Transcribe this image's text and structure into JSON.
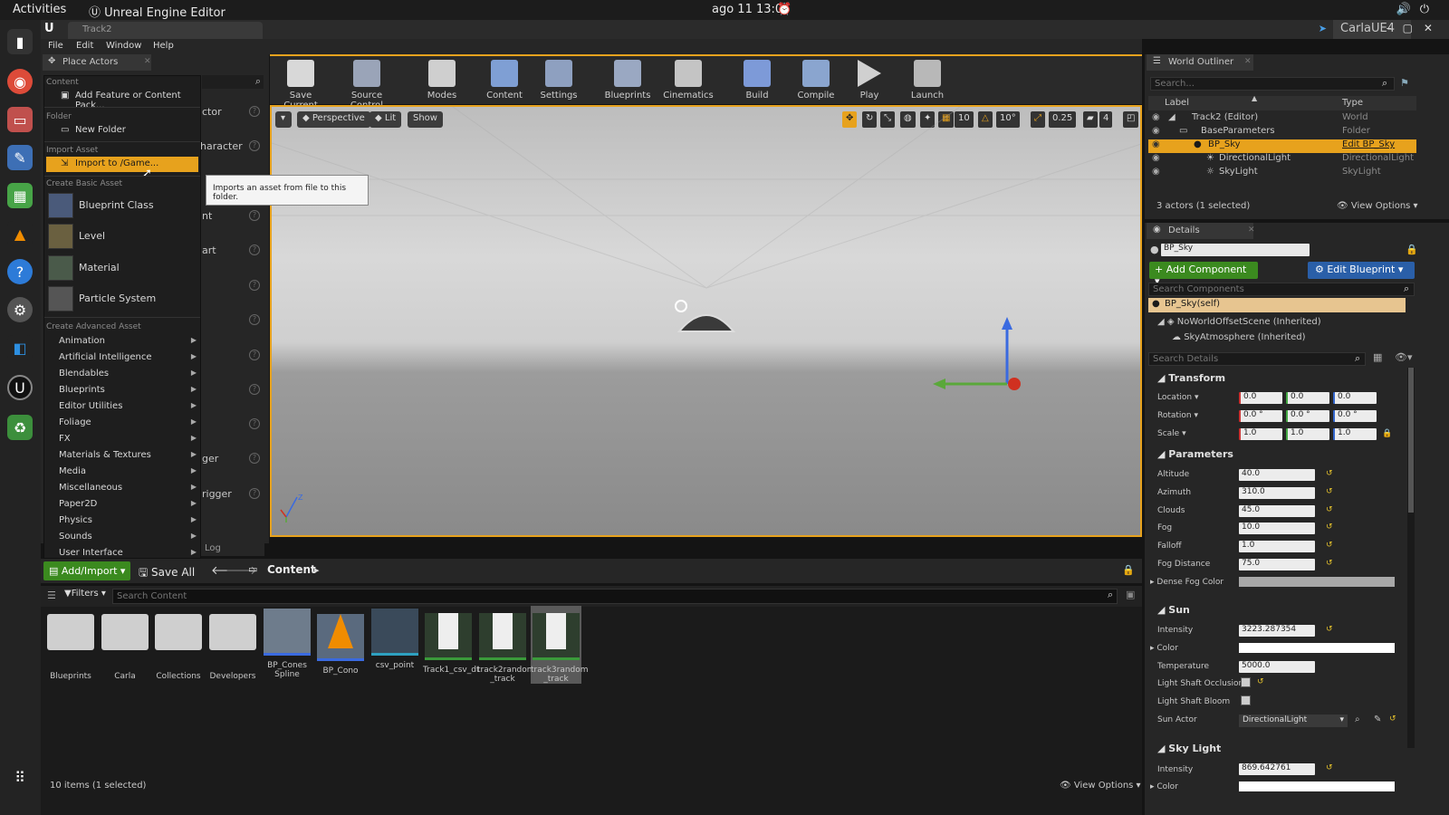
{
  "os": {
    "activities": "Activities",
    "app_name": "Unreal Engine Editor",
    "clock": "ago 11  13:04"
  },
  "window": {
    "tab_title": "Track2",
    "project": "CarlaUE4"
  },
  "menu": [
    "File",
    "Edit",
    "Window",
    "Help"
  ],
  "place_actors": {
    "tab": "Place Actors",
    "partial_labels": [
      "ctor",
      "haracter",
      "nt",
      "art",
      "ger",
      "rigger"
    ]
  },
  "dropdown": {
    "content_header": "Content",
    "add_feature": "Add Feature or Content Pack...",
    "folder_header": "Folder",
    "new_folder": "New Folder",
    "import_header": "Import Asset",
    "import_item": "Import to /Game...",
    "basic_header": "Create Basic Asset",
    "basic_items": [
      "Blueprint Class",
      "Level",
      "Material",
      "Particle System"
    ],
    "advanced_header": "Create Advanced Asset",
    "advanced_items": [
      "Animation",
      "Artificial Intelligence",
      "Blendables",
      "Blueprints",
      "Editor Utilities",
      "Foliage",
      "FX",
      "Materials & Textures",
      "Media",
      "Miscellaneous",
      "Paper2D",
      "Physics",
      "Sounds",
      "User Interface"
    ]
  },
  "tooltip": "Imports an asset from file to this folder.",
  "toolbar": [
    "Save Current",
    "Source Control",
    "Modes",
    "Content",
    "Settings",
    "Blueprints",
    "Cinematics",
    "Build",
    "Compile",
    "Play",
    "Launch"
  ],
  "viewport": {
    "perspective": "Perspective",
    "lit": "Lit",
    "show": "Show",
    "grid": "10",
    "angle": "10°",
    "scale": "0.25",
    "cam": "4"
  },
  "log_tab": "Log",
  "content_browser": {
    "add_import": "Add/Import",
    "save_all": "Save All",
    "path": "Content",
    "filters": "Filters",
    "search_placeholder": "Search Content",
    "assets": [
      "Blueprints",
      "Carla",
      "Collections",
      "Developers",
      "BP_Cones Spline",
      "BP_Cono",
      "csv_point",
      "Track1_csv_dt",
      "track2random _track",
      "track3random _track"
    ],
    "status": "10 items (1 selected)",
    "view_options": "View Options"
  },
  "outliner": {
    "tab": "World Outliner",
    "search_placeholder": "Search...",
    "col_label": "Label",
    "col_type": "Type",
    "rows": [
      {
        "label": "Track2 (Editor)",
        "type": "World"
      },
      {
        "label": "BaseParameters",
        "type": "Folder"
      },
      {
        "label": "BP_Sky",
        "type": "Edit BP_Sky"
      },
      {
        "label": "DirectionalLight",
        "type": "DirectionalLight"
      },
      {
        "label": "SkyLight",
        "type": "SkyLight"
      }
    ],
    "status": "3 actors (1 selected)",
    "view_options": "View Options"
  },
  "details": {
    "tab": "Details",
    "name": "BP_Sky",
    "add_component": "Add Component",
    "edit_blueprint": "Edit Blueprint",
    "search_components": "Search Components",
    "components": [
      "BP_Sky(self)",
      "NoWorldOffsetScene (Inherited)",
      "SkyAtmosphere (Inherited)"
    ],
    "search_details": "Search Details",
    "transform": "Transform",
    "location_label": "Location",
    "rotation_label": "Rotation",
    "scale_label": "Scale",
    "location": [
      "0.0",
      "0.0",
      "0.0"
    ],
    "rotation": [
      "0.0 °",
      "0.0 °",
      "0.0 °"
    ],
    "scale": [
      "1.0",
      "1.0",
      "1.0"
    ],
    "parameters": "Parameters",
    "params": [
      {
        "label": "Altitude",
        "value": "40.0"
      },
      {
        "label": "Azimuth",
        "value": "310.0"
      },
      {
        "label": "Clouds",
        "value": "45.0"
      },
      {
        "label": "Fog",
        "value": "10.0"
      },
      {
        "label": "Falloff",
        "value": "1.0"
      },
      {
        "label": "Fog Distance",
        "value": "75.0"
      }
    ],
    "dense_fog": "Dense Fog Color",
    "sun": "Sun",
    "sun_intensity_label": "Intensity",
    "sun_intensity": "3223.287354",
    "color_label": "Color",
    "temperature_label": "Temperature",
    "temperature": "5000.0",
    "shaft_occlusion": "Light Shaft Occlusion",
    "shaft_bloom": "Light Shaft Bloom",
    "sun_actor_label": "Sun Actor",
    "sun_actor": "DirectionalLight",
    "sky_light": "Sky Light",
    "sky_intensity_label": "Intensity",
    "sky_intensity": "869.642761",
    "sky_color_label": "Color"
  }
}
